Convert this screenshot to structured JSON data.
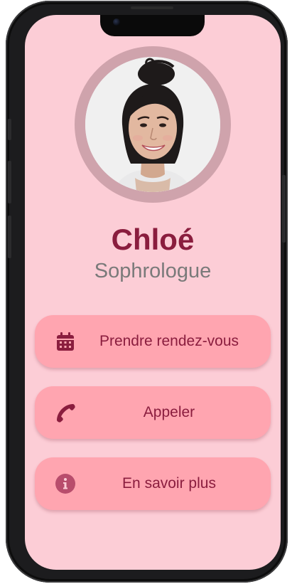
{
  "profile": {
    "name": "Chloé",
    "title": "Sophrologue"
  },
  "actions": [
    {
      "label": "Prendre rendez-vous",
      "icon": "calendar-icon"
    },
    {
      "label": "Appeler",
      "icon": "phone-icon"
    },
    {
      "label": "En savoir plus",
      "icon": "info-icon"
    }
  ],
  "colors": {
    "background": "#fccdd6",
    "button": "#ffa5b0",
    "accent": "#8a1d3e",
    "avatar_ring": "#cfa3ac",
    "subtitle": "#7a7a7a"
  }
}
